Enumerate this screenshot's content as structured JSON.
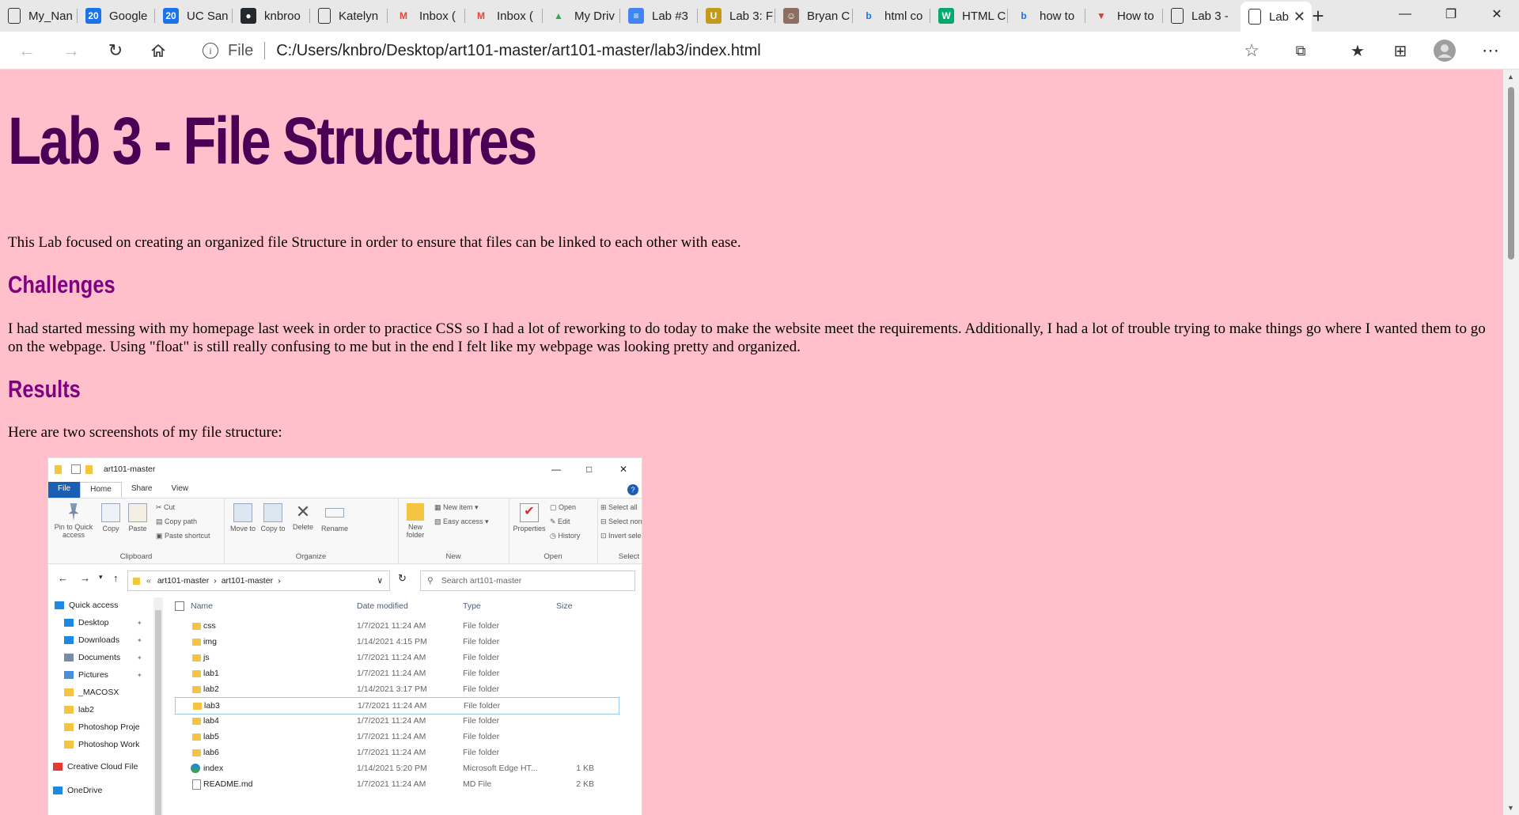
{
  "browser": {
    "tabs": [
      {
        "label": "My_Nan",
        "icon": "page-icon"
      },
      {
        "label": "Google",
        "icon": "calendar-icon"
      },
      {
        "label": "UC San",
        "icon": "calendar-icon"
      },
      {
        "label": "knbroo",
        "icon": "github-icon"
      },
      {
        "label": "Katelyn",
        "icon": "page-icon"
      },
      {
        "label": "Inbox (",
        "icon": "gmail-icon"
      },
      {
        "label": "Inbox (",
        "icon": "gmail-icon"
      },
      {
        "label": "My Driv",
        "icon": "drive-icon"
      },
      {
        "label": "Lab #3",
        "icon": "docs-icon"
      },
      {
        "label": "Lab 3: F",
        "icon": "ucsc-icon"
      },
      {
        "label": "Bryan C",
        "icon": "image-icon"
      },
      {
        "label": "html co",
        "icon": "bing-icon"
      },
      {
        "label": "HTML C",
        "icon": "w3schools-icon"
      },
      {
        "label": "how to",
        "icon": "bing-icon"
      },
      {
        "label": "How to",
        "icon": "v-icon"
      },
      {
        "label": "Lab 3 -",
        "icon": "page-icon"
      },
      {
        "label": "Lab",
        "icon": "page-icon"
      }
    ],
    "address": {
      "scheme_label": "File",
      "url": "C:/Users/knbro/Desktop/art101-master/art101-master/lab3/index.html"
    }
  },
  "page": {
    "title": "Lab 3 - File Structures",
    "intro": "This Lab focused on creating an organized file Structure in order to ensure that files can be linked to each other with ease.",
    "challenges_heading": "Challenges",
    "challenges_text": "I had started messing with my homepage last week in order to practice CSS so I had a lot of reworking to do today to make the website meet the requirements. Additionally, I had a lot of trouble trying to make things go where I wanted them to go on the webpage. Using \"float\" is still really confusing to me but in the end I felt like my webpage was looking pretty and organized.",
    "results_heading": "Results",
    "results_text": "Here are two screenshots of my file structure:"
  },
  "explorer": {
    "window_title": "art101-master",
    "ribbon_tabs": [
      "File",
      "Home",
      "Share",
      "View"
    ],
    "ribbon": {
      "clipboard": {
        "label": "Clipboard",
        "pin": "Pin to Quick access",
        "copy": "Copy",
        "paste": "Paste",
        "cut": "Cut",
        "copy_path": "Copy path",
        "paste_shortcut": "Paste shortcut"
      },
      "organize": {
        "label": "Organize",
        "move_to": "Move to",
        "copy_to": "Copy to",
        "delete": "Delete",
        "rename": "Rename"
      },
      "new": {
        "label": "New",
        "new_folder": "New folder",
        "new_item": "New item",
        "easy_access": "Easy access"
      },
      "open": {
        "label": "Open",
        "properties": "Properties",
        "open": "Open",
        "edit": "Edit",
        "history": "History"
      },
      "select": {
        "label": "Select",
        "select_all": "Select all",
        "select_none": "Select none",
        "invert": "Invert selection"
      }
    },
    "breadcrumb": [
      "art101-master",
      "art101-master"
    ],
    "search_placeholder": "Search art101-master",
    "columns": [
      "Name",
      "Date modified",
      "Type",
      "Size"
    ],
    "nav": [
      {
        "label": "Quick access",
        "color": "#1e88e5"
      },
      {
        "label": "Desktop",
        "color": "#1e88e5"
      },
      {
        "label": "Downloads",
        "color": "#1e88e5"
      },
      {
        "label": "Documents",
        "color": "#7a8ca3"
      },
      {
        "label": "Pictures",
        "color": "#4a90d9"
      },
      {
        "label": "_MACOSX",
        "color": "#f5c542"
      },
      {
        "label": "lab2",
        "color": "#f5c542"
      },
      {
        "label": "Photoshop Proje",
        "color": "#f5c542"
      },
      {
        "label": "Photoshop Work",
        "color": "#f5c542"
      },
      {
        "label": "Creative Cloud File",
        "color": "#e53935"
      },
      {
        "label": "OneDrive",
        "color": "#1e88e5"
      }
    ],
    "files": [
      {
        "name": "css",
        "date": "1/7/2021 11:24 AM",
        "type": "File folder",
        "size": ""
      },
      {
        "name": "img",
        "date": "1/14/2021 4:15 PM",
        "type": "File folder",
        "size": ""
      },
      {
        "name": "js",
        "date": "1/7/2021 11:24 AM",
        "type": "File folder",
        "size": ""
      },
      {
        "name": "lab1",
        "date": "1/7/2021 11:24 AM",
        "type": "File folder",
        "size": ""
      },
      {
        "name": "lab2",
        "date": "1/14/2021 3:17 PM",
        "type": "File folder",
        "size": ""
      },
      {
        "name": "lab3",
        "date": "1/7/2021 11:24 AM",
        "type": "File folder",
        "size": ""
      },
      {
        "name": "lab4",
        "date": "1/7/2021 11:24 AM",
        "type": "File folder",
        "size": ""
      },
      {
        "name": "lab5",
        "date": "1/7/2021 11:24 AM",
        "type": "File folder",
        "size": ""
      },
      {
        "name": "lab6",
        "date": "1/7/2021 11:24 AM",
        "type": "File folder",
        "size": ""
      },
      {
        "name": "index",
        "date": "1/14/2021 5:20 PM",
        "type": "Microsoft Edge HT...",
        "size": "1 KB"
      },
      {
        "name": "README.md",
        "date": "1/7/2021 11:24 AM",
        "type": "MD File",
        "size": "2 KB"
      }
    ]
  }
}
